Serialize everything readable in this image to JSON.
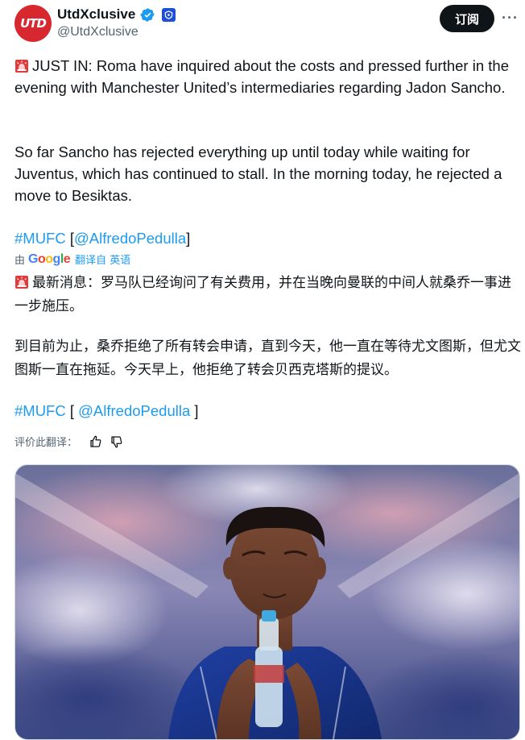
{
  "account": {
    "display_name": "UtdXclusive",
    "handle": "@UtdXclusive",
    "avatar_text": "UTD"
  },
  "header": {
    "subscribe_label": "订阅",
    "more_label": "···"
  },
  "tweet": {
    "p1": "JUST IN: Roma have inquired about the costs and pressed further in the evening with Manchester United’s intermediaries regarding Jadon Sancho.",
    "p2": "So far Sancho has rejected everything up until today while waiting for Juventus, which has continued to stall. In the morning today, he rejected a move to Besiktas.",
    "hashtag": "#MUFC",
    "bracket_open": "[",
    "mention": "@AlfredoPedulla",
    "bracket_close": "]"
  },
  "translation": {
    "by_label": "由",
    "google_letters": [
      "G",
      "o",
      "o",
      "g",
      "l",
      "e"
    ],
    "google_colors": [
      "#4285f4",
      "#ea4335",
      "#fbbc05",
      "#4285f4",
      "#34a853",
      "#ea4335"
    ],
    "translated_from": "翻译自 英语",
    "p1": "最新消息：罗马队已经询问了有关费用，并在当晚向曼联的中间人就桑乔一事进一步施压。",
    "p2": "到目前为止，桑乔拒绝了所有转会申请，直到今天，他一直在等待尤文图斯，但尤文图斯一直在拖延。今天早上，他拒绝了转会贝西克塔斯的提议。",
    "hashtag": "#MUFC",
    "bracket_open": "[ ",
    "mention": "@AlfredoPedulla",
    "bracket_close": " ]",
    "rate_label": "评价此翻译："
  },
  "colors": {
    "link": "#1d9bf0",
    "text": "#0f1419",
    "muted": "#536471",
    "avatar_bg": "#d8282f",
    "button_bg": "#0f1419"
  },
  "icons": {
    "verified": "verified-badge-icon",
    "affiliate": "affiliate-badge-icon",
    "siren": "siren-emoji-icon",
    "thumbs_up": "thumbs-up-icon",
    "thumbs_down": "thumbs-down-icon"
  }
}
